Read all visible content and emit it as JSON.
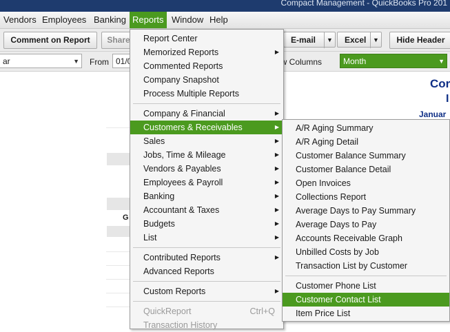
{
  "window": {
    "title": "Compact Management  - QuickBooks Pro 201"
  },
  "menubar": {
    "items": [
      "Vendors",
      "Employees",
      "Banking",
      "Reports",
      "Window",
      "Help"
    ],
    "active": "Reports"
  },
  "toolbar": {
    "comment_on_report": "Comment on Report",
    "share": "Share",
    "email": "E-mail",
    "excel": "Excel",
    "hide_header": "Hide Header"
  },
  "filterbar": {
    "dates_value": "ar",
    "from_label": "From",
    "from_value": "01/0",
    "columns_label": "ow Columns",
    "columns_value": "Month"
  },
  "report_preview": {
    "company_fragment": "Cor",
    "title_fragment": "I",
    "date_fragment": "Januar",
    "col_fragment": "G"
  },
  "reports_menu": {
    "items": [
      "Report Center",
      "Memorized Reports",
      "Commented Reports",
      "Company Snapshot",
      "Process Multiple Reports",
      "Company & Financial",
      "Customers & Receivables",
      "Sales",
      "Jobs, Time & Mileage",
      "Vendors & Payables",
      "Employees & Payroll",
      "Banking",
      "Accountant & Taxes",
      "Budgets",
      "List",
      "Contributed Reports",
      "Advanced Reports",
      "Custom Reports",
      "QuickReport",
      "Transaction History"
    ],
    "quickreport_shortcut": "Ctrl+Q",
    "highlighted": "Customers & Receivables"
  },
  "customers_submenu": {
    "items": [
      "A/R Aging Summary",
      "A/R Aging Detail",
      "Customer Balance Summary",
      "Customer Balance Detail",
      "Open Invoices",
      "Collections Report",
      "Average Days to Pay Summary",
      "Average Days to Pay",
      "Accounts Receivable Graph",
      "Unbilled Costs by Job",
      "Transaction List by Customer",
      "Customer Phone List",
      "Customer Contact List",
      "Item Price List"
    ],
    "highlighted": "Customer Contact List"
  },
  "colors": {
    "highlight": "#4b9a1f",
    "title_bar": "#1e3b6e",
    "report_text": "#0f2f86"
  }
}
